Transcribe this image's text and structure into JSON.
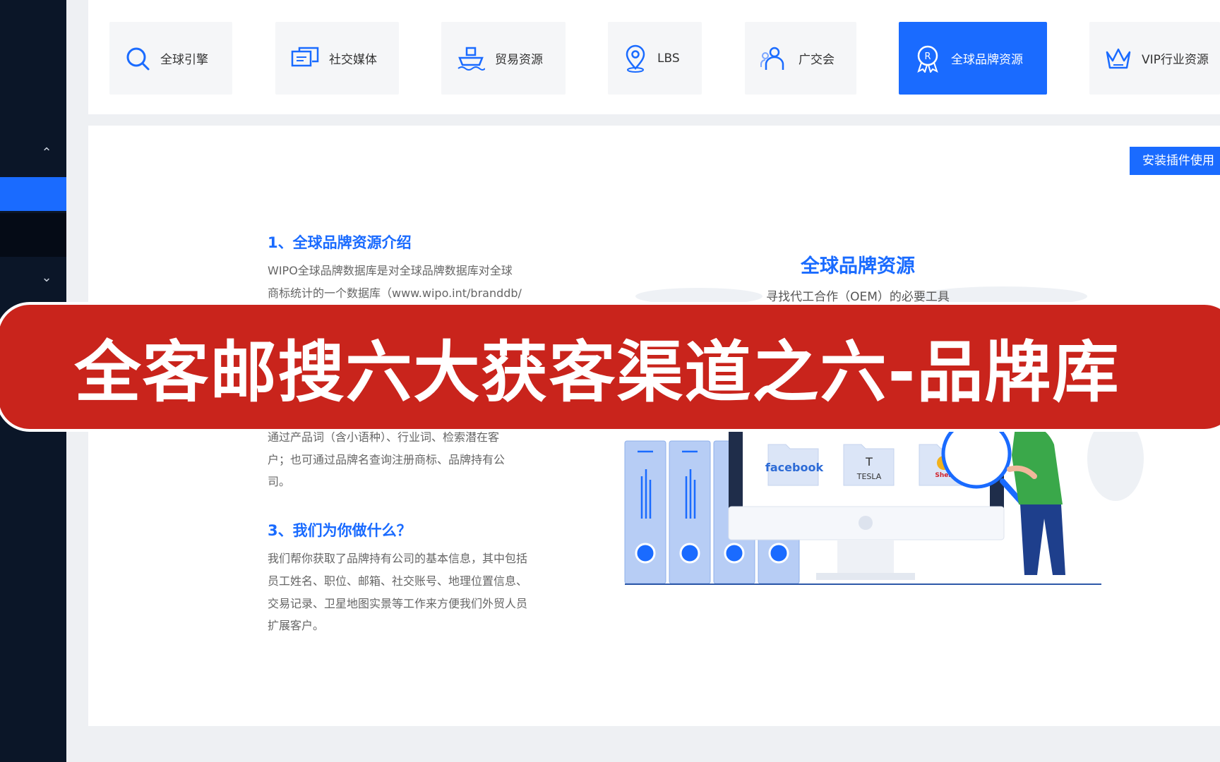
{
  "tabs": [
    {
      "label": "全球引擎",
      "icon": "search-icon",
      "active": false
    },
    {
      "label": "社交媒体",
      "icon": "chat-icon",
      "active": false
    },
    {
      "label": "贸易资源",
      "icon": "ship-icon",
      "active": false
    },
    {
      "label": "LBS",
      "icon": "location-pin-icon",
      "active": false
    },
    {
      "label": "广交会",
      "icon": "people-icon",
      "active": false
    },
    {
      "label": "全球品牌资源",
      "icon": "registered-badge-icon",
      "active": true
    },
    {
      "label": "VIP行业资源",
      "icon": "crown-icon",
      "active": false
    }
  ],
  "install_button": "安装插件使用",
  "sections": {
    "s1_title": "1、全球品牌资源介绍",
    "s1_line1": "WIPO全球品牌数据库是对全球品牌数据库对全球",
    "s1_line2": "商标统计的一个数据库（www.wipo.int/branddb/",
    "s2_line1": "通过产品词（含小语种）、行业词、检索潜在客",
    "s2_line2": "户；也可通过品牌名查询注册商标、品牌持有公",
    "s2_line3": "司。",
    "s3_title": "3、我们为你做什么？",
    "s3_line1": "我们帮你获取了品牌持有公司的基本信息，其中包括",
    "s3_line2": "员工姓名、职位、邮箱、社交账号、地理位置信息、",
    "s3_line3": "交易记录、卫星地图实景等工作来方便我们外贸人员",
    "s3_line4": "扩展客户。"
  },
  "illustration": {
    "title": "全球品牌资源",
    "subtitle": "寻找代工合作（OEM）的必要工具",
    "folder_labels": [
      "facebook",
      "TESLA",
      "Shell"
    ]
  },
  "banner": {
    "text": "全客邮搜六大获客渠道之六-品牌库"
  },
  "colors": {
    "accent": "#1a6bff",
    "sidebar": "#0b1628",
    "banner": "#c9241c"
  }
}
